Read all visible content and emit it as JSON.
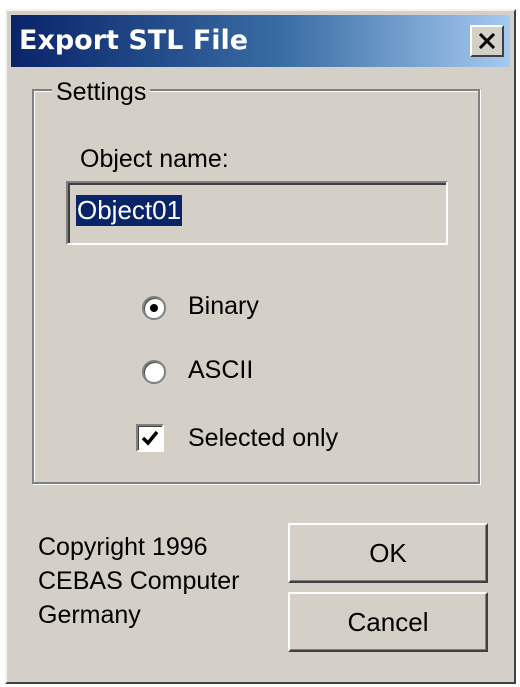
{
  "window": {
    "title": "Export STL File",
    "close_icon": "close-icon"
  },
  "settings": {
    "group_label": "Settings",
    "object_name_label": "Object name:",
    "object_name_value": "Object01",
    "format_options": [
      {
        "label": "Binary",
        "selected": true
      },
      {
        "label": "ASCII",
        "selected": false
      }
    ],
    "selected_only_label": "Selected only",
    "selected_only_checked": true
  },
  "footer": {
    "copyright_lines": [
      "Copyright 1996",
      "CEBAS Computer",
      "Germany"
    ],
    "ok_label": "OK",
    "cancel_label": "Cancel"
  }
}
